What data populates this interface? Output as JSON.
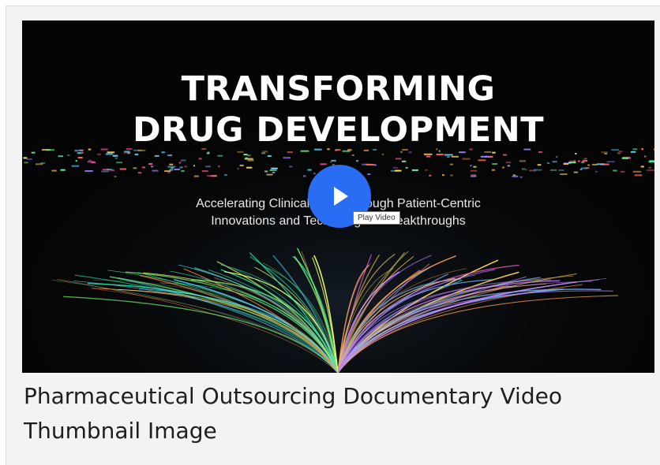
{
  "video": {
    "title_line1": "TRANSFORMING",
    "title_line2": "DRUG DEVELOPMENT",
    "subtitle_line1": "Accelerating Clinical Trials Through Patient-Centric",
    "subtitle_line2": "Innovations and Technological Breakthroughs",
    "play_button_icon": "play-icon",
    "play_button_color": "#2a6df5",
    "tooltip": "Play Video"
  },
  "caption": "Pharmaceutical Outsourcing Documentary Video Thumbnail Image"
}
